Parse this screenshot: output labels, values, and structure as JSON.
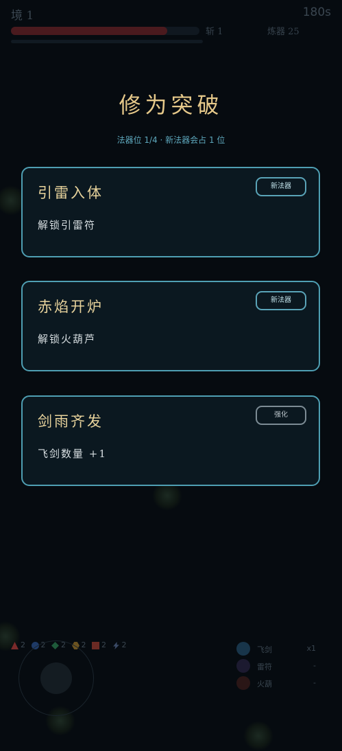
{
  "hud": {
    "realm": "境 1",
    "timer": "180s",
    "hp_fraction": 0.83,
    "kills": "斩 1",
    "refine": "炼器 25"
  },
  "overlay": {
    "title": "修为突破",
    "subtitle": "法器位 1/4 · 新法器会占 1 位"
  },
  "cards": [
    {
      "title": "引雷入体",
      "desc": "解锁引雷符",
      "tag": "新法器"
    },
    {
      "title": "赤焰开炉",
      "desc": "解锁火葫芦",
      "tag": "新法器"
    },
    {
      "title": "剑雨齐发",
      "desc": "飞剑数量 +1",
      "tag": "强化"
    }
  ],
  "elements": [
    {
      "icon": "triangle-icon",
      "count": "2",
      "color": "#7a2a2a"
    },
    {
      "icon": "circle-icon",
      "count": "2",
      "color": "#1e3a66"
    },
    {
      "icon": "diamond-icon",
      "count": "2",
      "color": "#1e5a3a"
    },
    {
      "icon": "hexagon-icon",
      "count": "2",
      "color": "#6a5220"
    },
    {
      "icon": "square-icon",
      "count": "2",
      "color": "#6a2a24"
    },
    {
      "icon": "lightning-icon",
      "count": "2",
      "color": "#3a4a66"
    }
  ],
  "weapons": [
    {
      "name": "飞剑",
      "level": "x1",
      "color": "#18354a"
    },
    {
      "name": "雷符",
      "level": "-",
      "color": "#1c1a30"
    },
    {
      "name": "火葫",
      "level": "-",
      "color": "#2a1616"
    }
  ]
}
